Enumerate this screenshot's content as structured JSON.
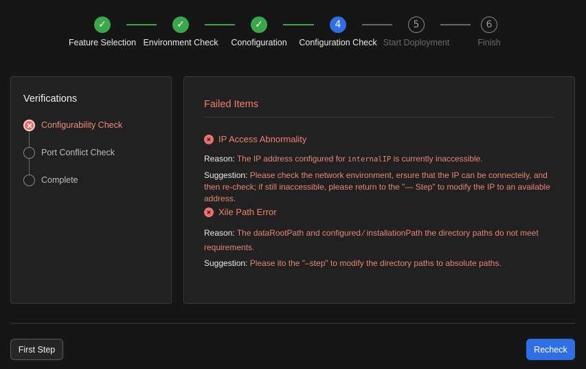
{
  "stepper": {
    "steps": [
      {
        "label": "Feature Selection",
        "status": "done",
        "marker": "✓"
      },
      {
        "label": "Environment Check",
        "status": "done",
        "marker": "✓"
      },
      {
        "label": "Conofiguration",
        "status": "done",
        "marker": "✓"
      },
      {
        "label": "Configuration Check",
        "status": "active",
        "marker": "4"
      },
      {
        "label": "Start Doployment",
        "status": "pending",
        "marker": "5"
      },
      {
        "label": "Finish",
        "status": "pending",
        "marker": "6"
      }
    ]
  },
  "verifications": {
    "title": "Verifications",
    "items": [
      {
        "label": "Configurability Check",
        "status": "failed"
      },
      {
        "label": "Port Conflict Check",
        "status": "pending"
      },
      {
        "label": "Complete",
        "status": "pending"
      }
    ]
  },
  "failed": {
    "title": "Failed Items",
    "items": [
      {
        "title": "IP Access Abnormality",
        "reason_label": "Reason:",
        "reason_pre": "The IP address configured for ",
        "reason_code": "internalIP",
        "reason_post": " is currently inaccessible.",
        "suggestion_label": "Suggestion:",
        "suggestion": "Please check the network environment, ersure that the IP can be connecteily, and then re-check; if still inaccessible, please return to the \"— Step\" to modify the IP to an available address."
      },
      {
        "title": "Xile Path Error",
        "reason_label": "Reason:",
        "reason": "The dataRootPath and configured ⁄ installationPath the directory paths do not meet requirements.",
        "suggestion_label": "Suggestion:",
        "suggestion": "Please ito the \"–step\" to modify the directory paths to absolute paths."
      }
    ]
  },
  "footer": {
    "first_step": "First Step",
    "recheck": "Recheck"
  },
  "colors": {
    "done": "#3aa84a",
    "active": "#2f6fe6",
    "error": "#f0806e",
    "background": "#161616",
    "panel": "#212121"
  }
}
